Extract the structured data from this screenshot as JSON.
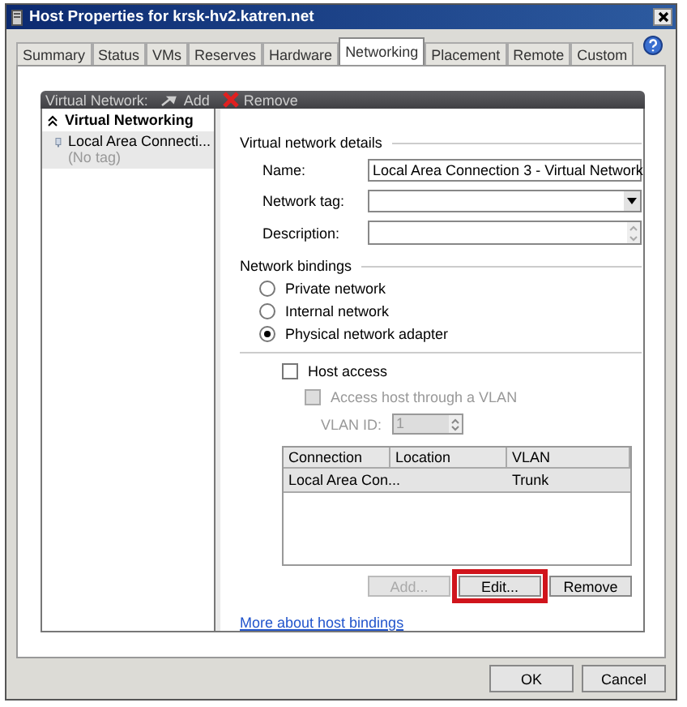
{
  "window": {
    "title": "Host Properties for krsk-hv2.katren.net"
  },
  "tabs": [
    {
      "label": "Summary",
      "selected": false
    },
    {
      "label": "Status",
      "selected": false
    },
    {
      "label": "VMs",
      "selected": false
    },
    {
      "label": "Reserves",
      "selected": false
    },
    {
      "label": "Hardware",
      "selected": false
    },
    {
      "label": "Networking",
      "selected": true
    },
    {
      "label": "Placement",
      "selected": false
    },
    {
      "label": "Remote",
      "selected": false
    },
    {
      "label": "Custom",
      "selected": false
    }
  ],
  "toolbar": {
    "label": "Virtual Network:",
    "buttons": [
      {
        "label": "Add",
        "kind": "add"
      },
      {
        "label": "Remove",
        "kind": "remove"
      }
    ]
  },
  "tree": {
    "header": "Virtual Networking",
    "items": [
      {
        "label": "Local Area Connecti...",
        "subtitle": "(No tag)",
        "selected": true
      }
    ]
  },
  "details": {
    "heading": "Virtual network details",
    "fields": [
      {
        "label": "Name:",
        "kind": "text",
        "value": "Local Area Connection 3 - Virtual Network"
      },
      {
        "label": "Network tag:",
        "kind": "dropdown"
      },
      {
        "label": "Description:",
        "kind": "multiline"
      }
    ]
  },
  "bindings": {
    "heading": "Network bindings",
    "options": [
      {
        "label": "Private network",
        "selected": false
      },
      {
        "label": "Internal network",
        "selected": false
      },
      {
        "label": "Physical network adapter",
        "selected": true
      }
    ]
  },
  "host_access": {
    "label": "Host access",
    "checked": false
  },
  "vlan_access": {
    "label": "Access host through a VLAN",
    "checked": false,
    "disabled": true
  },
  "vlan_id": {
    "label": "VLAN ID:",
    "value": "1",
    "disabled": true
  },
  "table": {
    "columns": [
      "Connection",
      "Location",
      "VLAN"
    ],
    "rows": [
      {
        "cells": [
          "Local Area Con...",
          "",
          "Trunk"
        ],
        "selected": true
      }
    ]
  },
  "binding_buttons": [
    {
      "label": "Add...",
      "disabled": true,
      "highlighted": false
    },
    {
      "label": "Edit...",
      "disabled": false,
      "highlighted": true
    },
    {
      "label": "Remove",
      "disabled": false,
      "highlighted": false
    }
  ],
  "link": "More about host bindings",
  "footer_buttons": [
    {
      "label": "OK"
    },
    {
      "label": "Cancel"
    }
  ]
}
